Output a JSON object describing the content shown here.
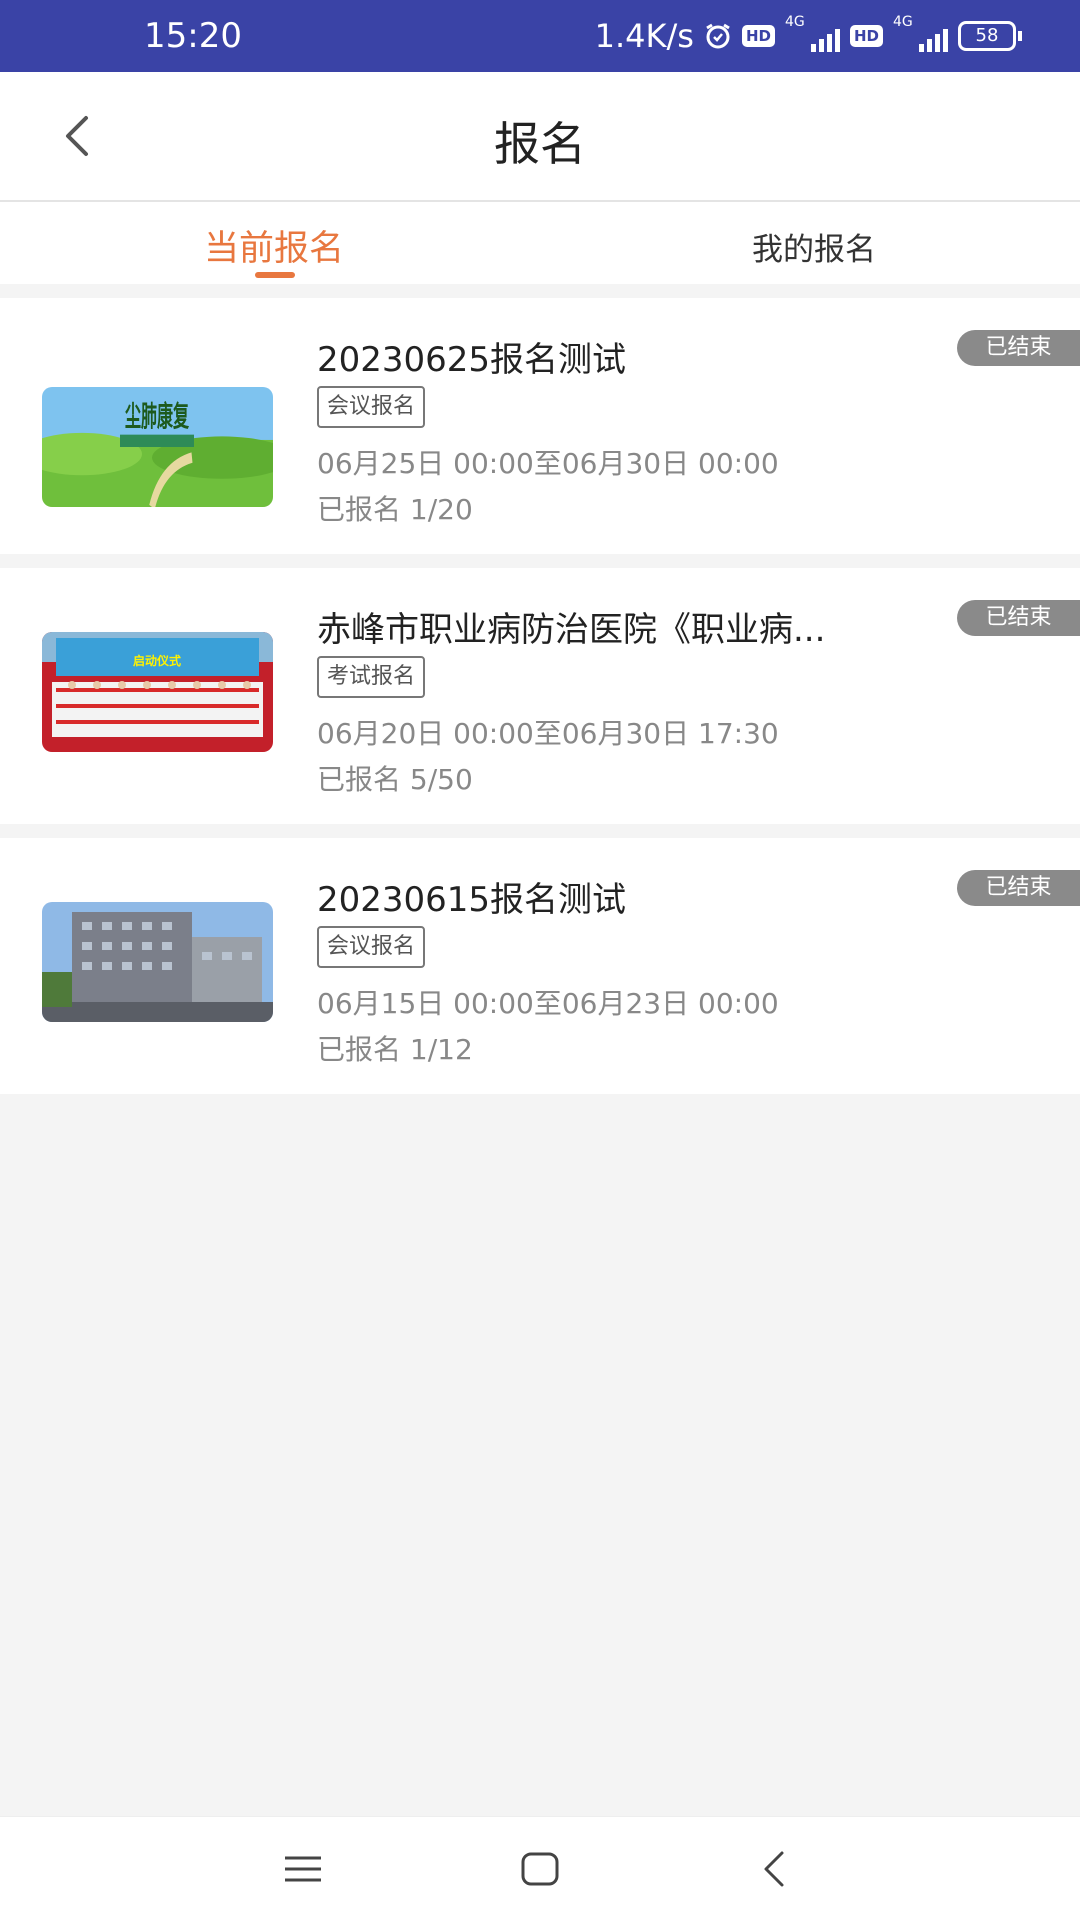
{
  "status_bar": {
    "time": "15:20",
    "net_speed": "1.4K/s",
    "icons": [
      "alarm-icon",
      "hd-icon",
      "signal-4g-icon",
      "hd-icon",
      "signal-4g-icon",
      "battery-icon"
    ],
    "hd_label": "HD",
    "network_label": "4G",
    "battery_level": "58"
  },
  "header": {
    "back_icon": "chevron-left-icon",
    "title": "报名"
  },
  "tabs": [
    {
      "label": "当前报名",
      "active": true
    },
    {
      "label": "我的报名",
      "active": false
    }
  ],
  "events": [
    {
      "title": "20230625报名测试",
      "tag": "会议报名",
      "time_range": "06月25日 00:00至06月30日 00:00",
      "registered": "已报名 1/20",
      "status": "已结束",
      "thumbnail_text": "尘肺康复"
    },
    {
      "title": "赤峰市职业病防治医院《职业病...",
      "tag": "考试报名",
      "time_range": "06月20日 00:00至06月30日 17:30",
      "registered": "已报名 5/50",
      "status": "已结束",
      "thumbnail_text": "启动仪式"
    },
    {
      "title": "20230615报名测试",
      "tag": "会议报名",
      "time_range": "06月15日 00:00至06月23日 00:00",
      "registered": "已报名 1/12",
      "status": "已结束",
      "thumbnail_text": ""
    }
  ],
  "nav_bar": {
    "icons": [
      "menu-icon",
      "home-square-icon",
      "back-triangle-icon"
    ]
  },
  "colors": {
    "status_bar": "#3a43a6",
    "accent": "#e8773f",
    "badge": "#8a8a8a",
    "background": "#f4f4f4"
  }
}
